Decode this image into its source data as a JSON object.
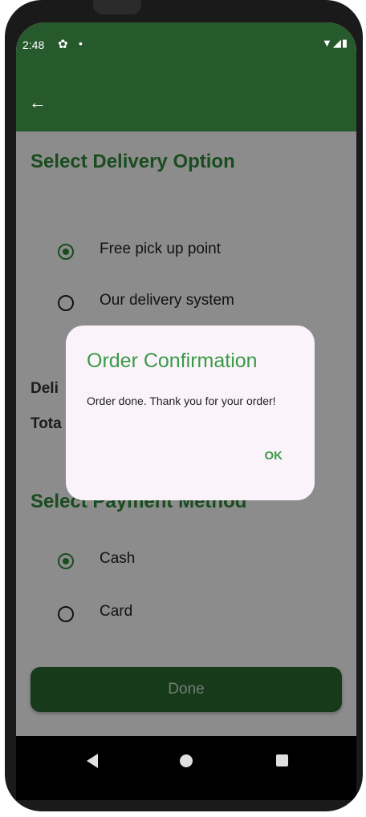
{
  "status_bar": {
    "time": "2:48",
    "settings_icon": "gear-icon",
    "notification_dot": "•",
    "right_icons": "▼◢▮"
  },
  "app_bar": {
    "back_icon": "arrow-left-icon",
    "back_glyph": "←"
  },
  "delivery": {
    "title": "Select Delivery Option",
    "options": [
      {
        "label": "Free pick up point",
        "selected": true
      },
      {
        "label": "Our delivery system",
        "selected": false
      }
    ]
  },
  "summary": {
    "delivery_label_partial": "Deli",
    "total_label_partial": "Tota"
  },
  "payment": {
    "title": "Select Payment Method",
    "options": [
      {
        "label": "Cash",
        "selected": true
      },
      {
        "label": "Card",
        "selected": false
      }
    ]
  },
  "done_button": {
    "label": "Done"
  },
  "dialog": {
    "title": "Order Confirmation",
    "message": "Order done. Thank you for your order!",
    "ok_label": "OK"
  },
  "colors": {
    "primary_dark": "#265a2d",
    "accent_green": "#2e8b3a",
    "dialog_background": "#fbf3fa"
  }
}
